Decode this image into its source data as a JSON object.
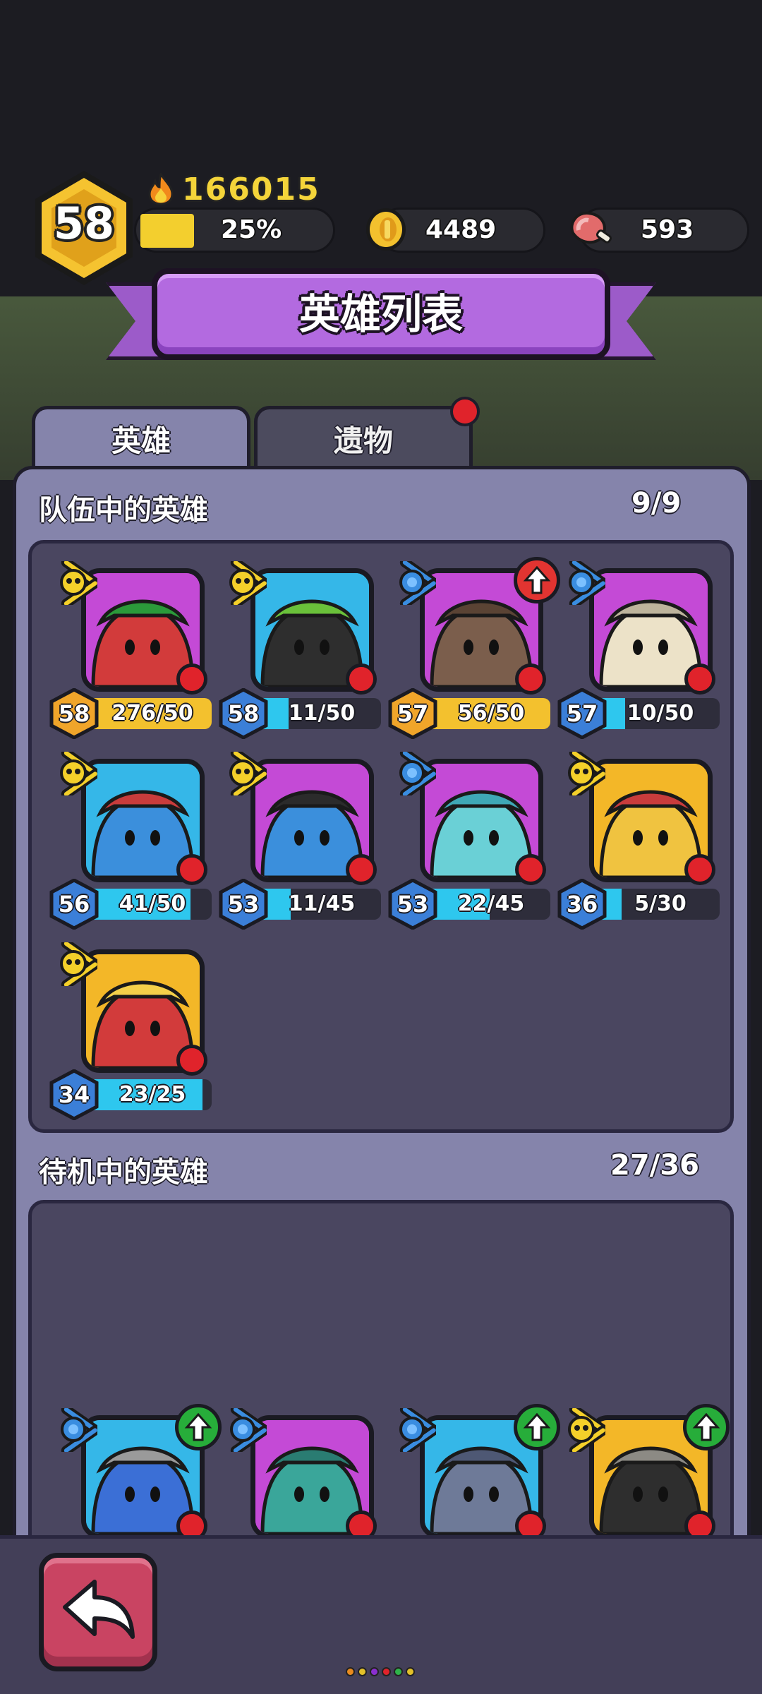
{
  "player": {
    "level": "58",
    "power": "166015",
    "xp_percent_label": "25%",
    "xp_fraction": 0.25,
    "gold": "4489",
    "meat": "593"
  },
  "title": "英雄列表",
  "tabs": [
    {
      "label": "英雄",
      "active": true
    },
    {
      "label": "遗物",
      "active": false,
      "has_notification": true
    }
  ],
  "team": {
    "title": "队伍中的英雄",
    "count": "9/9",
    "heroes": [
      {
        "level": "58",
        "progress": "276/50",
        "fill": 1.0,
        "bar_color": "#f3c12e",
        "role": "skull",
        "portrait_bg": "#c44ad6",
        "art": "green-hat-hero",
        "upgrade": null
      },
      {
        "level": "58",
        "progress": "11/50",
        "fill": 0.22,
        "bar_color": "#2ec7ee",
        "role": "skull",
        "portrait_bg": "#35b7e8",
        "art": "black-cat-hero",
        "upgrade": null
      },
      {
        "level": "57",
        "progress": "56/50",
        "fill": 1.0,
        "bar_color": "#f3c12e",
        "role": "star",
        "portrait_bg": "#c44ad6",
        "art": "treant-hero",
        "upgrade": "red"
      },
      {
        "level": "57",
        "progress": "10/50",
        "fill": 0.2,
        "bar_color": "#2ec7ee",
        "role": "star",
        "portrait_bg": "#c44ad6",
        "art": "mummy-hero",
        "upgrade": null
      },
      {
        "level": "56",
        "progress": "41/50",
        "fill": 0.82,
        "bar_color": "#2ec7ee",
        "role": "skull",
        "portrait_bg": "#35b7e8",
        "art": "horned-helmet-hero",
        "upgrade": null
      },
      {
        "level": "53",
        "progress": "11/45",
        "fill": 0.24,
        "bar_color": "#2ec7ee",
        "role": "skull",
        "portrait_bg": "#c44ad6",
        "art": "pirate-hero",
        "upgrade": null
      },
      {
        "level": "53",
        "progress": "22/45",
        "fill": 0.49,
        "bar_color": "#2ec7ee",
        "role": "star",
        "portrait_bg": "#c44ad6",
        "art": "bunny-hero",
        "upgrade": null
      },
      {
        "level": "36",
        "progress": "5/30",
        "fill": 0.17,
        "bar_color": "#2ec7ee",
        "role": "skull",
        "portrait_bg": "#f3b728",
        "art": "knight-hero",
        "upgrade": null
      },
      {
        "level": "34",
        "progress": "23/25",
        "fill": 0.92,
        "bar_color": "#2ec7ee",
        "role": "skull",
        "portrait_bg": "#f3b728",
        "art": "fire-hero",
        "upgrade": null
      }
    ]
  },
  "idle": {
    "title": "待机中的英雄",
    "count": "27/36",
    "heroes": [
      {
        "role": "star",
        "portrait_bg": "#35b7e8",
        "art": "spiked-helmet-hero",
        "upgrade": "green"
      },
      {
        "role": "star",
        "portrait_bg": "#c44ad6",
        "art": "dino-hero",
        "upgrade": null
      },
      {
        "role": "star",
        "portrait_bg": "#35b7e8",
        "art": "cloud-hero",
        "upgrade": "green"
      },
      {
        "role": "skull",
        "portrait_bg": "#f3b728",
        "art": "iron-helmet-hero",
        "upgrade": "green"
      }
    ]
  },
  "colors": {
    "panel": "#8584ab",
    "well": "#4a4660",
    "banner": "#b36ae0",
    "alert": "#e0232b",
    "page_dots": [
      "#e98b1f",
      "#e2c02a",
      "#8a2fcf",
      "#e0232b",
      "#2fb34a",
      "#e2c02a"
    ]
  },
  "icons": {
    "power": "flame-icon",
    "gold": "gold-coin-icon",
    "meat": "meat-icon",
    "back": "back-arrow-icon"
  }
}
